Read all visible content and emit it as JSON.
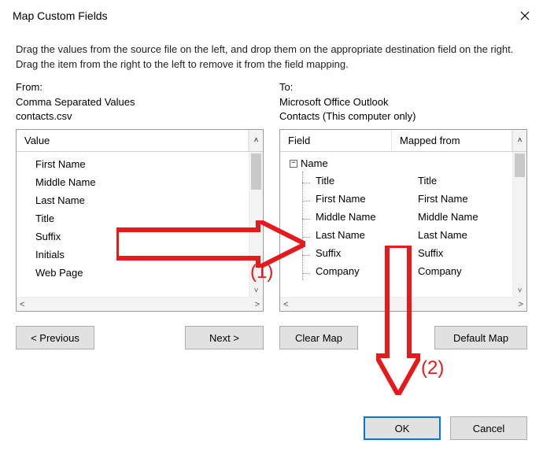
{
  "title": "Map Custom Fields",
  "instructions": "Drag the values from the source file on the left, and drop them on the appropriate destination field on the right.  Drag the item from the right to the left to remove it from the field mapping.",
  "from": {
    "label": "From:",
    "source_type": "Comma Separated Values",
    "filename": "contacts.csv",
    "header": "Value",
    "items": [
      "First Name",
      "Middle Name",
      "Last Name",
      "Title",
      "Suffix",
      "Initials",
      "Web Page"
    ]
  },
  "to": {
    "label": "To:",
    "app": "Microsoft Office Outlook",
    "folder": "Contacts (This computer only)",
    "header_field": "Field",
    "header_mapped": "Mapped from",
    "tree_root": "Name",
    "fields": [
      {
        "field": "Title",
        "mapped": "Title"
      },
      {
        "field": "First Name",
        "mapped": "First Name"
      },
      {
        "field": "Middle Name",
        "mapped": "Middle Name"
      },
      {
        "field": "Last Name",
        "mapped": "Last Name"
      },
      {
        "field": "Suffix",
        "mapped": "Suffix"
      },
      {
        "field": "Company",
        "mapped": "Company"
      }
    ]
  },
  "buttons": {
    "previous": "< Previous",
    "next": "Next >",
    "clear_map": "Clear Map",
    "default_map": "Default Map",
    "ok": "OK",
    "cancel": "Cancel"
  },
  "annotations": {
    "step1": "(1)",
    "step2": "(2)"
  }
}
